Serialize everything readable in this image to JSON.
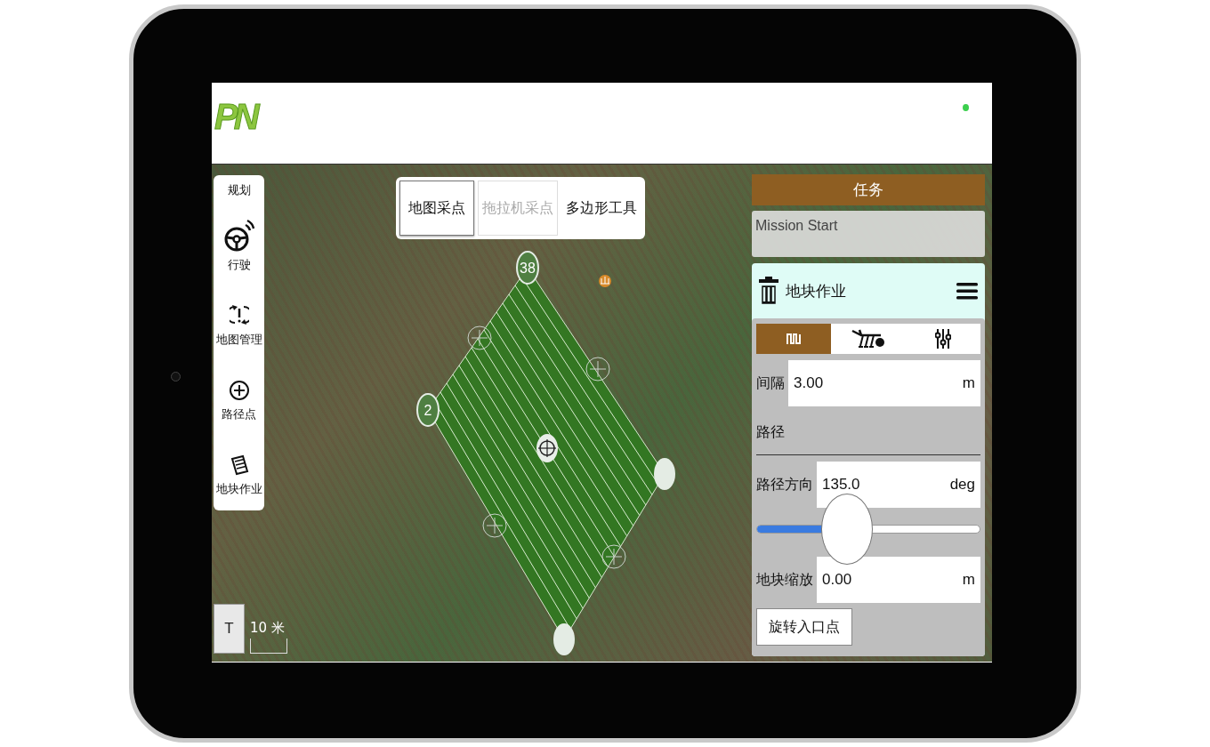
{
  "header": {
    "logo": "PN",
    "status_dot": true
  },
  "toolbar": {
    "title": "规划",
    "items": [
      {
        "kind": "drive",
        "label": "行驶"
      },
      {
        "kind": "map",
        "label": "地图管理"
      },
      {
        "kind": "waypoint",
        "label": "路径点"
      },
      {
        "kind": "field",
        "label": "地块作业"
      }
    ]
  },
  "modes": [
    {
      "label": "地图采点",
      "selected": true,
      "disabled": false
    },
    {
      "label": "拖拉机采点",
      "selected": false,
      "disabled": true
    },
    {
      "label": "多边形工具",
      "selected": false,
      "disabled": false
    }
  ],
  "map": {
    "vertex_labels": [
      "38",
      "2"
    ],
    "scale_label": "10 米",
    "layer_button": "T"
  },
  "task": {
    "title": "任务",
    "mission": "Mission Start"
  },
  "card": {
    "title": "地块作业",
    "tabs": [
      {
        "kind": "pattern",
        "selected": true
      },
      {
        "kind": "implement",
        "selected": false
      },
      {
        "kind": "settings",
        "selected": false
      }
    ],
    "spacing": {
      "label": "间隔",
      "value": "3.00",
      "unit": "m"
    },
    "section": "路径",
    "direction": {
      "label": "路径方向",
      "value": "135.0",
      "unit": "deg",
      "level": 0.4
    },
    "offset": {
      "label": "地块缩放",
      "value": "0.00",
      "unit": "m"
    },
    "button": "旋转入口点"
  }
}
